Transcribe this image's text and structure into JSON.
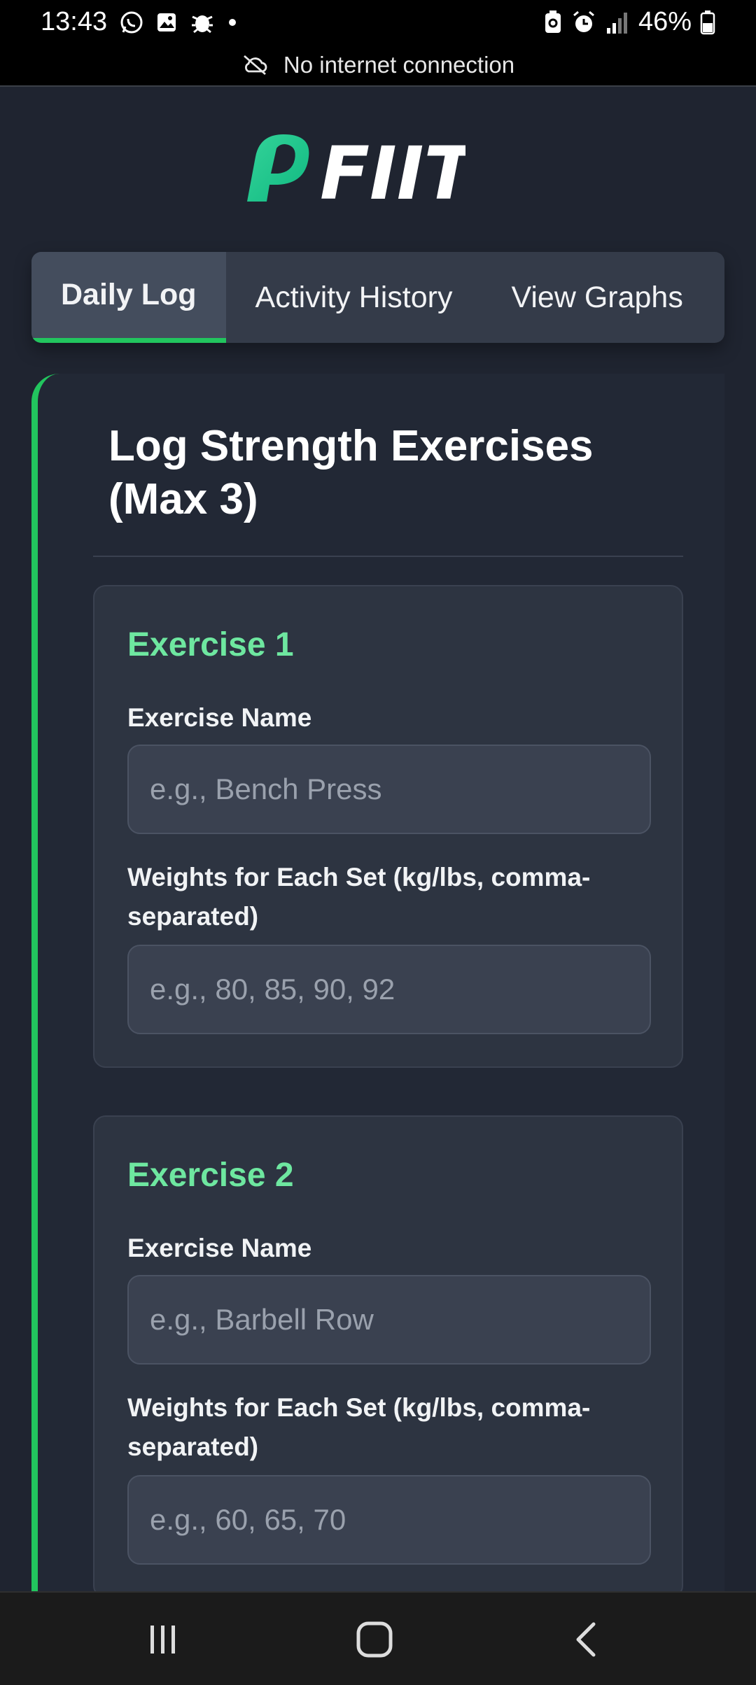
{
  "status_bar": {
    "time": "13:43",
    "battery": "46%",
    "left_icons": [
      "whatsapp-icon",
      "gallery-icon",
      "bug-icon",
      "dot-icon"
    ],
    "right_icons": [
      "battery-saver-icon",
      "alarm-icon",
      "signal-icon",
      "battery-icon"
    ]
  },
  "connection": {
    "message": "No internet connection",
    "icon": "cloud-off-icon"
  },
  "app": {
    "logo_text": "FIIT",
    "brand_color": "#22c55e",
    "tabs": [
      {
        "label": "Daily Log",
        "active": true
      },
      {
        "label": "Activity History",
        "active": false
      },
      {
        "label": "View Graphs",
        "active": false
      }
    ],
    "section_title": "Log Strength Exercises (Max 3)",
    "exercises": [
      {
        "title": "Exercise 1",
        "name_label": "Exercise Name",
        "name_placeholder": "e.g., Bench Press",
        "weights_label": "Weights for Each Set (kg/lbs, comma-separated)",
        "weights_placeholder": "e.g., 80, 85, 90, 92"
      },
      {
        "title": "Exercise 2",
        "name_label": "Exercise Name",
        "name_placeholder": "e.g., Barbell Row",
        "weights_label": "Weights for Each Set (kg/lbs, comma-separated)",
        "weights_placeholder": "e.g., 60, 65, 70"
      }
    ]
  },
  "nav_bar": {
    "buttons": [
      "recents-icon",
      "home-icon",
      "back-icon"
    ]
  }
}
